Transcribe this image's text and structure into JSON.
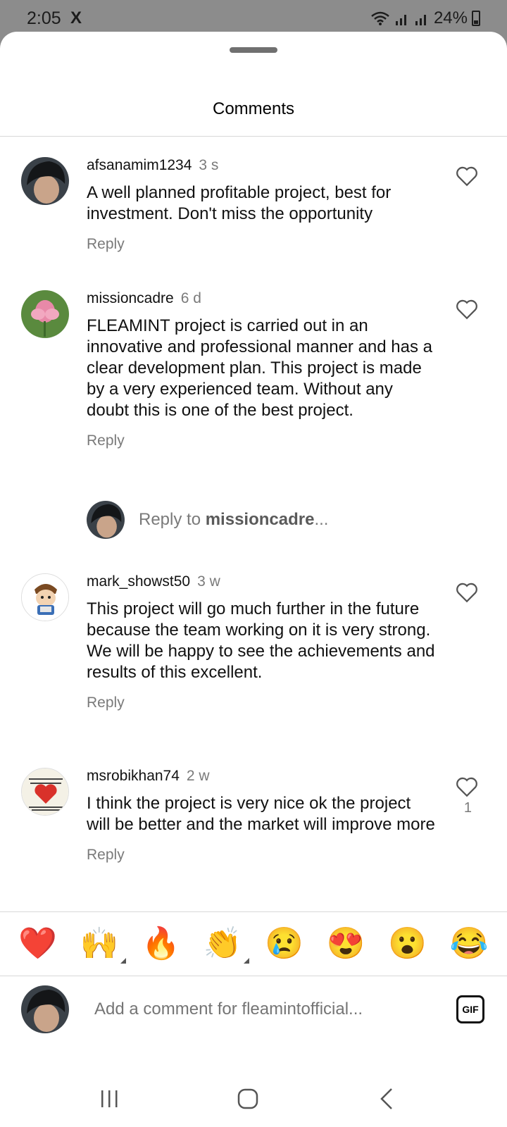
{
  "status": {
    "time": "2:05",
    "app_icon": "X",
    "battery": "24%"
  },
  "sheet": {
    "title": "Comments"
  },
  "comments": [
    {
      "user": "afsanamim1234",
      "time": "3 s",
      "text": "A well planned profitable project, best for investment. Don't miss the opportunity",
      "reply": "Reply",
      "likes": ""
    },
    {
      "user": "missioncadre",
      "time": "6 d",
      "text": "FLEAMINT project is carried out in an innovative and professional manner and has a clear development plan. This project is made by a very experienced team. Without any doubt this is one of the best project.",
      "reply": "Reply",
      "likes": ""
    },
    {
      "user": "mark_showst50",
      "time": "3 w",
      "text": "This project will go much further in the future because the team working on it is very strong.\nWe will be happy to see the achievements and results of this excellent.",
      "reply": "Reply",
      "likes": ""
    },
    {
      "user": "msrobikhan74",
      "time": "2 w",
      "text": "I think the project is very nice ok the project will be better and the market will improve more",
      "reply": "Reply",
      "likes": "1"
    }
  ],
  "reply_to": {
    "prefix": "Reply to ",
    "user": "missioncadre",
    "suffix": "..."
  },
  "emojis": [
    "❤️",
    "🙌",
    "🔥",
    "👏",
    "😢",
    "😍",
    "😮",
    "😂"
  ],
  "add_comment": {
    "placeholder": "Add a comment for fleamintofficial...",
    "gif_label": "GIF"
  },
  "colors": {
    "text": "#111111",
    "muted": "#7a7a7a",
    "statusbar": "#8c8c8c"
  }
}
